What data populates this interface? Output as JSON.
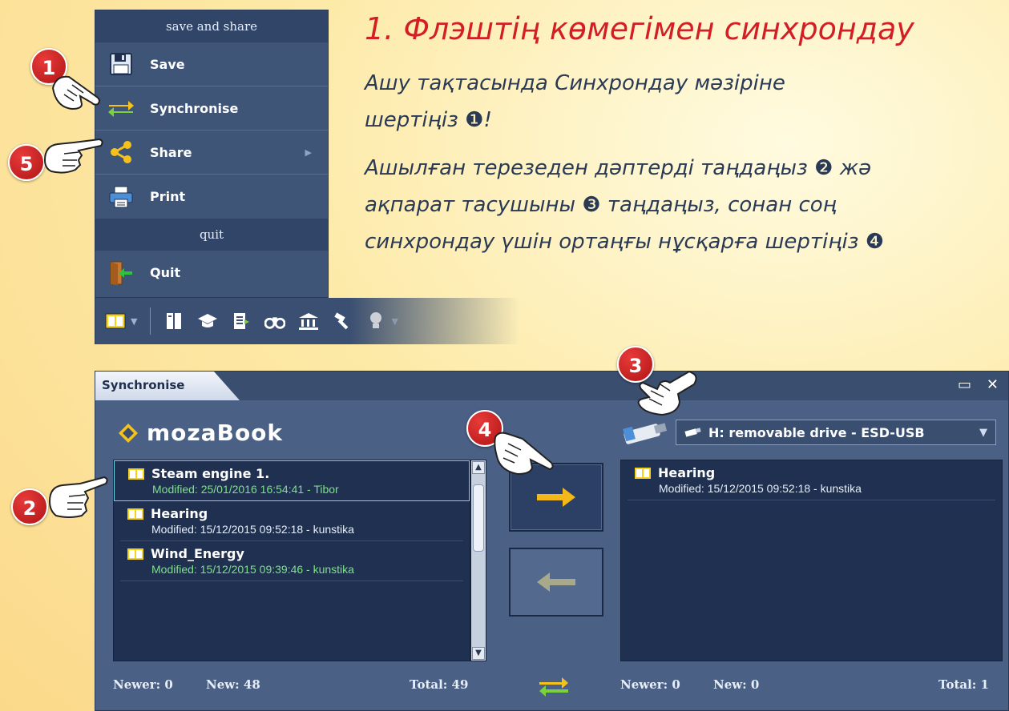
{
  "menu": {
    "header": "save and share",
    "items": [
      {
        "label": "Save",
        "icon": "floppy-disk-icon"
      },
      {
        "label": "Synchronise",
        "icon": "sync-arrows-icon"
      },
      {
        "label": "Share",
        "icon": "share-icon"
      },
      {
        "label": "Print",
        "icon": "printer-icon"
      }
    ],
    "quit_header": "quit",
    "quit_label": "Quit"
  },
  "instructions": {
    "heading": "1. Флэштің көмегімен синхрондау",
    "lines": [
      "Ашу тақтасында Синхрондау мәзіріне",
      "шертіңіз ❶!",
      "Ашылған терезеден дәптерді таңдаңыз ❷ жә",
      "ақпарат тасушыны ❸ таңдаңыз, сонан соң",
      "синхрондау үшін ортаңғы нұсқарға шертіңіз ❹"
    ]
  },
  "window": {
    "title": "Synchronise",
    "brand": "mozaBook",
    "left_list": [
      {
        "title": "Steam engine 1.",
        "subtitle": "Modified: 25/01/2016 16:54:41 - Tibor"
      },
      {
        "title": "Hearing",
        "subtitle": "Modified: 15/12/2015 09:52:18 - kunstika"
      },
      {
        "title": "Wind_Energy",
        "subtitle": "Modified: 15/12/2015 09:39:46 - kunstika"
      }
    ],
    "right_list": [
      {
        "title": "Hearing",
        "subtitle": "Modified: 15/12/2015 09:52:18 - kunstika"
      }
    ],
    "drive": "H: removable drive - ESD-USB",
    "left_footer": {
      "newer": "Newer: 0",
      "new": "New: 48",
      "total": "Total: 49"
    },
    "right_footer": {
      "newer": "Newer: 0",
      "new": "New: 0",
      "total": "Total: 1"
    }
  },
  "badges": [
    "1",
    "2",
    "3",
    "4",
    "5"
  ],
  "colors": {
    "accent_red": "#d21f26",
    "panel": "#1f3050",
    "highlight_green": "#7fe08a"
  }
}
